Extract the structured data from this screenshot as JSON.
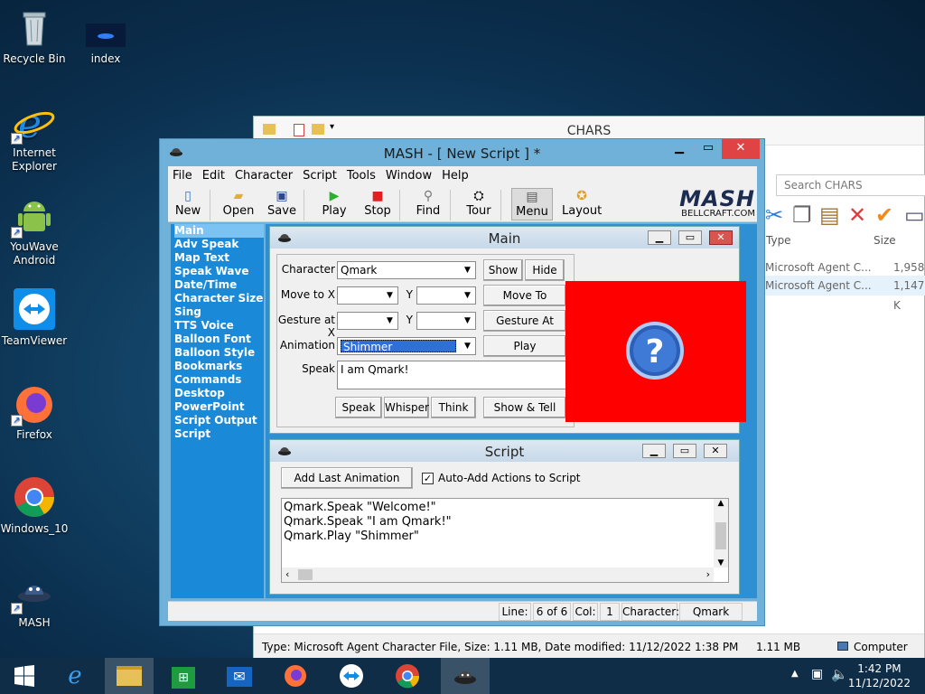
{
  "desktop": {
    "icons": [
      {
        "label": "Recycle Bin",
        "icon": "recycle-bin-icon"
      },
      {
        "label": "index",
        "icon": "image-file-icon"
      },
      {
        "label": "Internet Explorer",
        "icon": "internet-explorer-icon"
      },
      {
        "label": "YouWave Android",
        "icon": "android-icon"
      },
      {
        "label": "TeamViewer",
        "icon": "teamviewer-icon"
      },
      {
        "label": "Firefox",
        "icon": "firefox-icon"
      },
      {
        "label": "Windows_10",
        "icon": "chrome-icon"
      },
      {
        "label": "MASH",
        "icon": "mash-icon"
      }
    ]
  },
  "explorer": {
    "title": "CHARS",
    "search_placeholder": "Search CHARS",
    "col_type": "Type",
    "col_size": "Size",
    "rows": [
      {
        "type": "Microsoft Agent C...",
        "size": "1,958 K"
      },
      {
        "type": "Microsoft Agent C...",
        "size": "1,147 K"
      }
    ],
    "status": {
      "info": "Type: Microsoft Agent Character File, Size: 1.11 MB, Date modified: 11/12/2022 1:38 PM",
      "size": "1.11 MB",
      "location": "Computer"
    }
  },
  "mash": {
    "title": "MASH - [ New Script ] *",
    "menu": [
      "File",
      "Edit",
      "Character",
      "Script",
      "Tools",
      "Window",
      "Help"
    ],
    "toolbar": {
      "new": "New",
      "open": "Open",
      "save": "Save",
      "play": "Play",
      "stop": "Stop",
      "find": "Find",
      "tour": "Tour",
      "menu": "Menu",
      "layout": "Layout"
    },
    "logo": {
      "text": "MASH",
      "sub": "BELLCRAFT.COM"
    },
    "sidebar": [
      "Main",
      "Adv Speak",
      "Map Text",
      "Speak Wave",
      "Date/Time",
      "Character Size",
      "Sing",
      "TTS Voice",
      "Balloon Font",
      "Balloon Style",
      "Bookmarks",
      "Commands",
      "Desktop",
      "PowerPoint",
      "Script Output",
      "Script"
    ],
    "main_window": {
      "title": "Main",
      "character_label": "Character",
      "character_value": "Qmark",
      "moveto_label": "Move to X",
      "gestureat_label": "Gesture at X",
      "y_label": "Y",
      "animation_label": "Animation",
      "animation_value": "Shimmer",
      "speak_label": "Speak",
      "speak_value": "I am Qmark!",
      "buttons": {
        "show": "Show",
        "hide": "Hide",
        "move_to": "Move To",
        "gesture_at": "Gesture At",
        "play_animation": "Play Animation",
        "speak": "Speak",
        "whisper": "Whisper",
        "think": "Think",
        "show_tell": "Show & Tell"
      }
    },
    "script_window": {
      "title": "Script",
      "add_last": "Add Last Animation",
      "auto_add": "Auto-Add Actions to Script",
      "auto_add_checked": true,
      "lines": [
        "Qmark.Speak \"Welcome!\"",
        "Qmark.Speak \"I am Qmark!\"",
        "Qmark.Play \"Shimmer\""
      ]
    },
    "status": {
      "line_label": "Line:",
      "line_value": "6 of 6",
      "col_label": "Col:",
      "col_value": "1",
      "char_label": "Character:",
      "char_value": "Qmark"
    }
  },
  "agent": {
    "background": "#ff0000",
    "glyph": "?"
  },
  "taskbar": {
    "items": [
      "start-icon",
      "internet-explorer-icon",
      "file-explorer-icon",
      "store-icon",
      "mail-icon",
      "firefox-icon",
      "teamviewer-icon",
      "chrome-icon",
      "mash-icon"
    ],
    "time": "1:42 PM",
    "date": "11/12/2022"
  },
  "colors": {
    "sidebar": "#1a8ad8",
    "selection": "#7ac3f2",
    "close": "#e04343"
  }
}
